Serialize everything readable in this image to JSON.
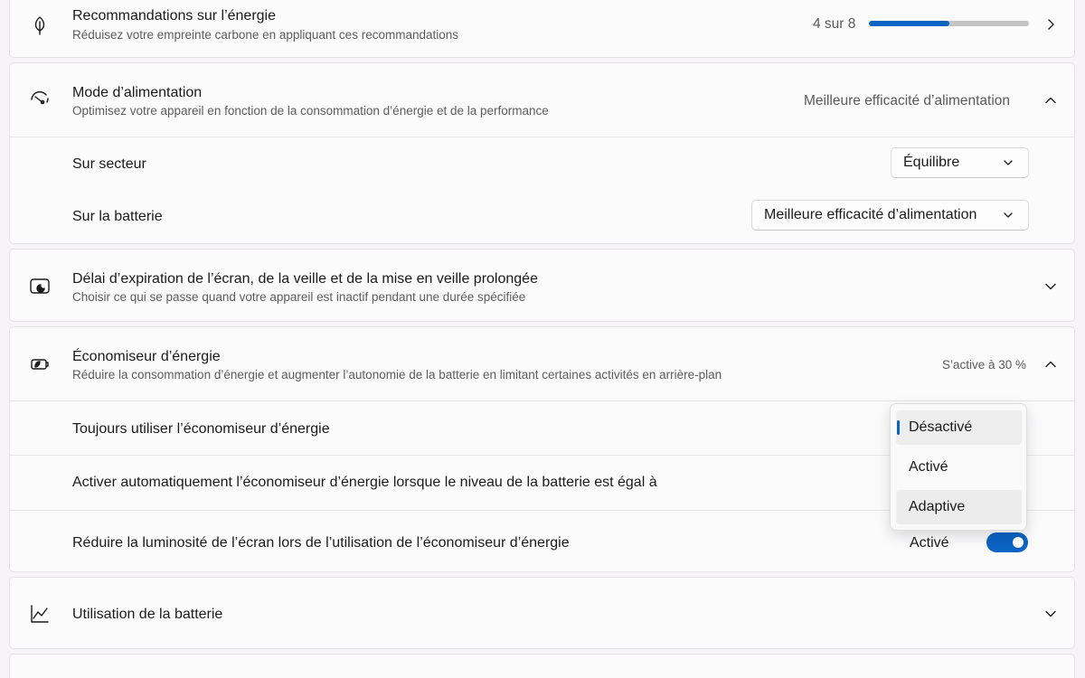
{
  "energy_recommendations": {
    "title": "Recommandations sur l’énergie",
    "subtitle": "Réduisez votre empreinte carbone en appliquant ces recommandations",
    "progress_text": "4 sur 8",
    "progress_fraction": 0.5,
    "icon": "leaf-icon"
  },
  "power_mode": {
    "title": "Mode d’alimentation",
    "subtitle": "Optimisez votre appareil en fonction de la consommation d’énergie et de la performance",
    "value": "Meilleure efficacité d’alimentation",
    "icon": "gauge-icon",
    "on_ac": {
      "label": "Sur secteur",
      "selected": "Équilibre"
    },
    "on_battery": {
      "label": "Sur la batterie",
      "selected": "Meilleure efficacité d’alimentation"
    }
  },
  "screen_timeout": {
    "title": "Délai d’expiration de l’écran, de la veille et de la mise en veille prolongée",
    "subtitle": "Choisir ce qui se passe quand votre appareil est inactif pendant une durée spécifiée",
    "icon": "screen-sleep-icon"
  },
  "energy_saver": {
    "title": "Économiseur d’énergie",
    "subtitle": "Réduire la consommation d’énergie et augmenter l’autonomie de la batterie en limitant certaines activités en arrière-plan",
    "status": "S’active à 30 %",
    "icon": "battery-saver-icon",
    "always_use": {
      "label": "Toujours utiliser l’économiseur d’énergie"
    },
    "auto_activate": {
      "label": "Activer automatiquement l’économiseur d’énergie lorsque le niveau de la batterie est égal à"
    },
    "reduce_brightness": {
      "label": "Réduire la luminosité de l’écran lors de l’utilisation de l’économiseur d’énergie",
      "state_label": "Activé",
      "enabled": true
    },
    "menu": {
      "options": [
        "Désactivé",
        "Activé",
        "Adaptive"
      ],
      "selected": "Désactivé"
    }
  },
  "battery_usage": {
    "title": "Utilisation de la batterie",
    "icon": "chart-line-icon"
  },
  "colors": {
    "accent": "#0b63c4"
  }
}
